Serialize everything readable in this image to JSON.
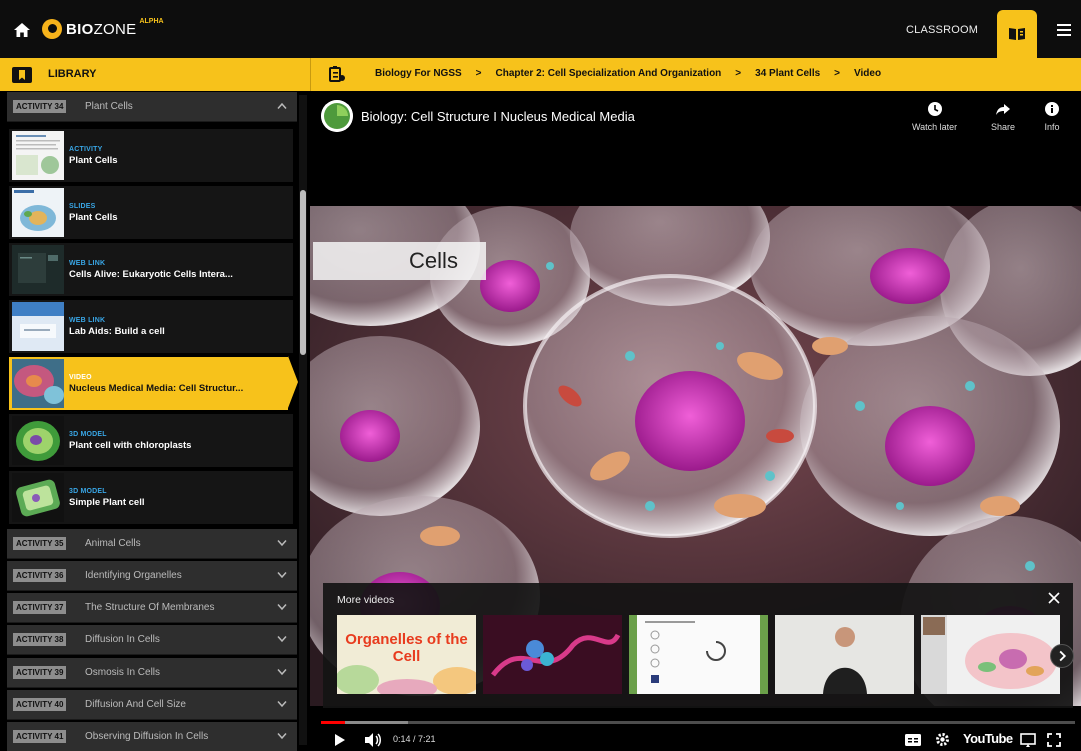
{
  "topbar": {
    "brand_bold": "BIO",
    "brand_light": "ZONE",
    "brand_tag": "ALPHA",
    "classroom_label": "CLASSROOM",
    "accent": "#f7c21b"
  },
  "library": {
    "title": "LIBRARY"
  },
  "breadcrumb": [
    "Biology For NGSS",
    "Chapter 2: Cell Specialization And Organization",
    "34 Plant Cells",
    "Video"
  ],
  "breadcrumb_sep": ">",
  "sidebar": {
    "current_activity": {
      "badge": "ACTIVITY 34",
      "name": "Plant Cells"
    },
    "resources": [
      {
        "type": "ACTIVITY",
        "title": "Plant Cells",
        "icon": "document-thumbnail"
      },
      {
        "type": "SLIDES",
        "title": "Plant Cells",
        "icon": "slides-thumbnail"
      },
      {
        "type": "WEB LINK",
        "title": "Cells Alive: Eukaryotic Cells Intera...",
        "icon": "web-link-thumbnail"
      },
      {
        "type": "WEB LINK",
        "title": "Lab Aids: Build a cell",
        "icon": "web-link-thumbnail"
      },
      {
        "type": "VIDEO",
        "title": "Nucleus Medical Media: Cell Structur...",
        "icon": "video-thumbnail",
        "active": true
      },
      {
        "type": "3D MODEL",
        "title": "Plant cell with chloroplasts",
        "icon": "3d-model-thumbnail"
      },
      {
        "type": "3D MODEL",
        "title": "Simple Plant cell",
        "icon": "3d-model-thumbnail"
      }
    ],
    "activities": [
      {
        "badge": "ACTIVITY 35",
        "name": "Animal Cells"
      },
      {
        "badge": "ACTIVITY 36",
        "name": "Identifying Organelles"
      },
      {
        "badge": "ACTIVITY 37",
        "name": "The Structure Of Membranes"
      },
      {
        "badge": "ACTIVITY 38",
        "name": "Diffusion In Cells"
      },
      {
        "badge": "ACTIVITY 39",
        "name": "Osmosis In Cells"
      },
      {
        "badge": "ACTIVITY 40",
        "name": "Diffusion And Cell Size"
      },
      {
        "badge": "ACTIVITY 41",
        "name": "Observing Diffusion In Cells"
      }
    ]
  },
  "video": {
    "title": "Biology: Cell Structure I Nucleus Medical Media",
    "actions": [
      {
        "label": "Watch later",
        "icon": "clock-icon"
      },
      {
        "label": "Share",
        "icon": "share-icon"
      },
      {
        "label": "Info",
        "icon": "info-icon"
      }
    ],
    "overlay_label": "Cells",
    "more_videos": {
      "title": "More videos",
      "items": [
        {
          "caption": "Organelles of the Cell"
        },
        {
          "caption": ""
        },
        {
          "caption": ""
        },
        {
          "caption": ""
        },
        {
          "caption": ""
        }
      ]
    },
    "time": "0:14 / 7:21",
    "progress_played": 0.032,
    "progress_loaded": 0.115,
    "youtube_label": "YouTube"
  }
}
